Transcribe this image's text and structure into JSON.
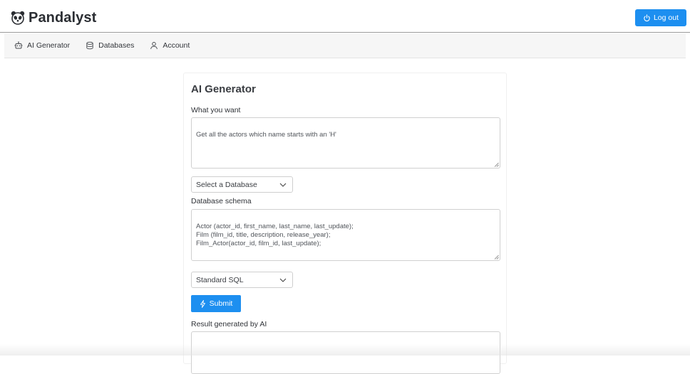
{
  "header": {
    "brand_name": "Pandalyst",
    "logout_label": "Log out"
  },
  "nav": {
    "items": [
      {
        "label": "AI Generator",
        "icon": "robot-icon"
      },
      {
        "label": "Databases",
        "icon": "database-icon"
      },
      {
        "label": "Account",
        "icon": "user-icon"
      }
    ]
  },
  "main": {
    "title": "AI Generator",
    "prompt_label": "What you want",
    "prompt_value": "Get all the actors which name starts with an 'H'",
    "database_select_value": "Select a Database",
    "schema_label": "Database schema",
    "schema_value": "Actor (actor_id, first_name, last_name, last_update);\nFilm (film_id, title, description, release_year);\nFilm_Actor(actor_id, film_id, last_update);",
    "dialect_select_value": "Standard SQL",
    "submit_label": "Submit",
    "result_label": "Result generated by AI",
    "result_value": ""
  },
  "colors": {
    "primary": "#1d8ff0",
    "nav_background": "#f6f6f6"
  }
}
